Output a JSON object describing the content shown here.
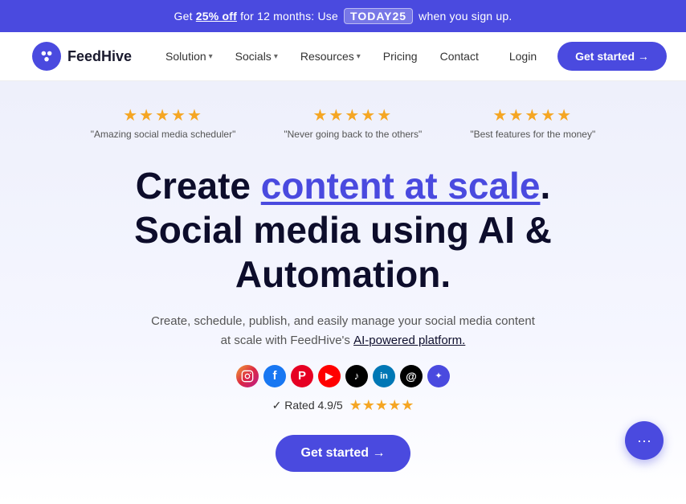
{
  "banner": {
    "text_prefix": "Get ",
    "off_text": "25% off",
    "text_middle": " for 12 months: Use ",
    "code": "TODAY25",
    "text_suffix": " when you sign up."
  },
  "navbar": {
    "logo_text": "FeedHive",
    "nav_items": [
      {
        "label": "Solution",
        "has_dropdown": true
      },
      {
        "label": "Socials",
        "has_dropdown": true
      },
      {
        "label": "Resources",
        "has_dropdown": true
      }
    ],
    "pricing_label": "Pricing",
    "contact_label": "Contact",
    "login_label": "Login",
    "cta_label": "Get started →"
  },
  "stars_row": [
    {
      "label": "\"Amazing social media scheduler\""
    },
    {
      "label": "\"Never going back to the others\""
    },
    {
      "label": "\"Best features for the money\""
    }
  ],
  "hero": {
    "line1_prefix": "Create ",
    "line1_highlight": "content at scale",
    "line1_suffix": ".",
    "line2": "Social media using AI & Automation.",
    "sub1": "Create, schedule, publish, and easily manage your social media content",
    "sub2": "at scale with FeedHive's ",
    "sub2_link": "AI-powered platform.",
    "cta_label": "Get started →"
  },
  "rating": {
    "check_text": "✓ Rated 4.9/5"
  },
  "social_platforms": [
    {
      "name": "instagram",
      "icon": "📷",
      "class": "si-instagram"
    },
    {
      "name": "facebook",
      "icon": "f",
      "class": "si-facebook"
    },
    {
      "name": "pinterest",
      "icon": "P",
      "class": "si-pinterest"
    },
    {
      "name": "youtube",
      "icon": "▶",
      "class": "si-youtube"
    },
    {
      "name": "tiktok",
      "icon": "♪",
      "class": "si-tiktok"
    },
    {
      "name": "linkedin",
      "icon": "in",
      "class": "si-linkedin"
    },
    {
      "name": "threads",
      "icon": "@",
      "class": "si-threads"
    },
    {
      "name": "extra",
      "icon": "✦",
      "class": "si-extra"
    }
  ],
  "chat": {
    "icon": "···"
  }
}
